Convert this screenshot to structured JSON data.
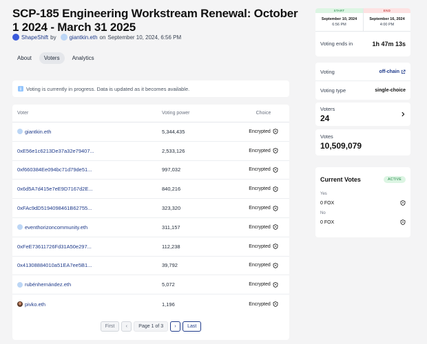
{
  "proposal": {
    "title": "SCP-185 Engineering Workstream Renewal: October 1 2024 - March 31 2025",
    "space": "ShapeShift",
    "by": "by",
    "author": "giantkin.eth",
    "on": "on",
    "date": "September 10, 2024, 6:56 PM"
  },
  "tabs": [
    {
      "label": "About",
      "active": false
    },
    {
      "label": "Voters",
      "active": true
    },
    {
      "label": "Analytics",
      "active": false
    }
  ],
  "notice": "Voting is currently in progress. Data is updated as it becomes available.",
  "table": {
    "headers": {
      "voter": "Voter",
      "power": "Voting power",
      "choice": "Choice"
    },
    "rows": [
      {
        "voter": "giantkin.eth",
        "power": "5,344,435",
        "choice": "Encrypted",
        "avatar": "blue"
      },
      {
        "voter": "0xE56e1c6213De37a32e79407...",
        "power": "2,533,126",
        "choice": "Encrypted",
        "avatar": "none"
      },
      {
        "voter": "0xf660384Ee094bc71d79de51...",
        "power": "997,032",
        "choice": "Encrypted",
        "avatar": "none"
      },
      {
        "voter": "0x6d5A7d415e7eE9D7167d2E...",
        "power": "840,216",
        "choice": "Encrypted",
        "avatar": "none"
      },
      {
        "voter": "0xFAc9dD5194098461B62755...",
        "power": "323,320",
        "choice": "Encrypted",
        "avatar": "none"
      },
      {
        "voter": "eventhorizoncommunity.eth",
        "power": "311,157",
        "choice": "Encrypted",
        "avatar": "blue"
      },
      {
        "voter": "0xFeE73611726Fd31A50e297...",
        "power": "112,238",
        "choice": "Encrypted",
        "avatar": "none"
      },
      {
        "voter": "0x41308884010a51EA7ee5B1...",
        "power": "39,792",
        "choice": "Encrypted",
        "avatar": "none"
      },
      {
        "voter": "rubénhernández.eth",
        "power": "5,072",
        "choice": "Encrypted",
        "avatar": "blue"
      },
      {
        "voter": "pivko.eth",
        "power": "1,196",
        "choice": "Encrypted",
        "avatar": "photo"
      }
    ]
  },
  "pagination": {
    "first": "First",
    "prev": "‹",
    "info": "Page 1 of 3",
    "next": "›",
    "last": "Last"
  },
  "timeline": {
    "start_label": "START",
    "start_date": "September 10, 2024",
    "start_time": "6:56 PM",
    "end_label": "END",
    "end_date": "September 16, 2024",
    "end_time": "4:00 PM",
    "ends_label": "Voting ends in",
    "ends_value": "1h 47m 13s"
  },
  "details": {
    "voting_label": "Voting",
    "voting_value": "off-chain",
    "type_label": "Voting type",
    "type_value": "single-choice"
  },
  "stats": {
    "voters_label": "Voters",
    "voters_value": "24",
    "votes_label": "Votes",
    "votes_value": "10,509,079"
  },
  "current_votes": {
    "title": "Current Votes",
    "badge": "ACTIVE",
    "options": [
      {
        "label": "Yes",
        "value": "0 FOX"
      },
      {
        "label": "No",
        "value": "0 FOX"
      }
    ]
  },
  "colors": {
    "accent": "#1e3a8a",
    "active_green": "#15803d",
    "end_red": "#b91c1c",
    "background": "#f4f4f5"
  }
}
